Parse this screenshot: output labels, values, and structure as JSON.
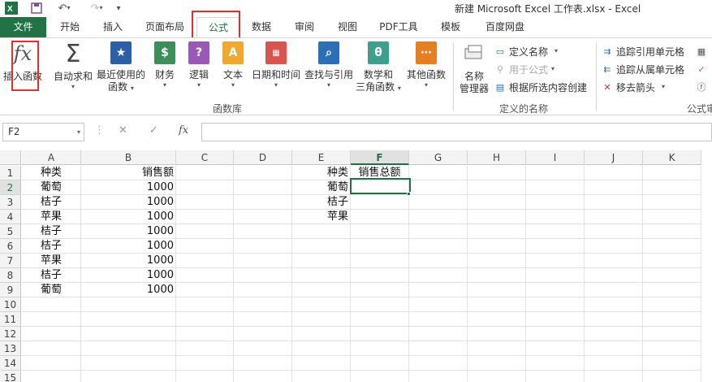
{
  "window": {
    "title": "新建 Microsoft Excel 工作表.xlsx - Excel"
  },
  "quick_access": {
    "app_icon": "excel-icon",
    "save_icon": "save-icon",
    "undo_icon": "undo-icon",
    "redo_icon": "redo-icon",
    "customize_icon": "customize-icon"
  },
  "tabs": {
    "file": "文件",
    "items": [
      "开始",
      "插入",
      "页面布局",
      "公式",
      "数据",
      "审阅",
      "视图",
      "PDF工具",
      "模板",
      "百度网盘"
    ],
    "active": "公式"
  },
  "ribbon": {
    "insert_function": "插入函数",
    "autosum": "自动求和",
    "recently_used_1": "最近使用的",
    "recently_used_2": "函数",
    "financial": "财务",
    "logical": "逻辑",
    "text": "文本",
    "datetime": "日期和时间",
    "lookup": "查找与引用",
    "math_1": "数学和",
    "math_2": "三角函数",
    "more": "其他函数",
    "group_library": "函数库",
    "name_manager_1": "名称",
    "name_manager_2": "管理器",
    "define_name": "定义名称",
    "use_in_formula": "用于公式",
    "create_from_selection": "根据所选内容创建",
    "group_defined_names": "定义的名称",
    "trace_precedents": "追踪引用单元格",
    "trace_dependents": "追踪从属单元格",
    "remove_arrows": "移去箭头",
    "group_formula_auditing": "公式审"
  },
  "formula_bar": {
    "name_box": "F2",
    "cancel_icon": "✕",
    "enter_icon": "✓",
    "fx_icon": "fx",
    "value": ""
  },
  "sheet": {
    "columns": [
      "A",
      "B",
      "C",
      "D",
      "E",
      "F",
      "G",
      "H",
      "I",
      "J",
      "K"
    ],
    "rows": [
      "1",
      "2",
      "3",
      "4",
      "5",
      "6",
      "7",
      "8",
      "9",
      "10",
      "11",
      "12",
      "13",
      "14",
      "15"
    ],
    "active_cell": "F2",
    "data_a": [
      "种类",
      "葡萄",
      "桔子",
      "苹果",
      "桔子",
      "桔子",
      "苹果",
      "桔子",
      "葡萄"
    ],
    "data_b": [
      "销售额",
      "1000",
      "1000",
      "1000",
      "1000",
      "1000",
      "1000",
      "1000",
      "1000"
    ],
    "data_e": [
      "种类",
      "葡萄",
      "桔子",
      "苹果"
    ],
    "f1": "销售总额"
  }
}
